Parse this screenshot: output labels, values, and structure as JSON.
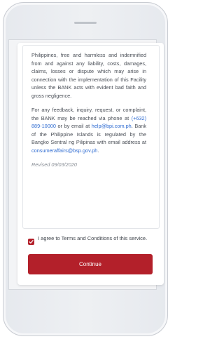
{
  "terms": {
    "paragraph1": "Philippines, free and harmless and indemnified from and against any liability, costs, damages, claims, losses or dispute which may arise in connection with the implementation of this Facility unless the BANK acts with evident bad faith and gross negligence.",
    "p2_part1": "For any feedback, inquiry, request, or complaint, the BANK may be reached via phone at ",
    "phone": "(+632) 889-10000",
    "p2_part2": " or by email at ",
    "email": "help@bpi.com.ph",
    "p2_part3": ". Bank of the Philippine Islands is regulated by the Bangko Sentral ng Pilipinas with email address at ",
    "regulator_email": "consumeraffairs@bsp.gov.ph",
    "p2_part4": ".",
    "revised": "Revised 09/03/2020"
  },
  "agreement": {
    "checked": true,
    "label": "I agree to Terms and Conditions of this service."
  },
  "buttons": {
    "continue_label": "Continue"
  },
  "colors": {
    "accent": "#b3202a",
    "link": "#2e6bd1"
  }
}
